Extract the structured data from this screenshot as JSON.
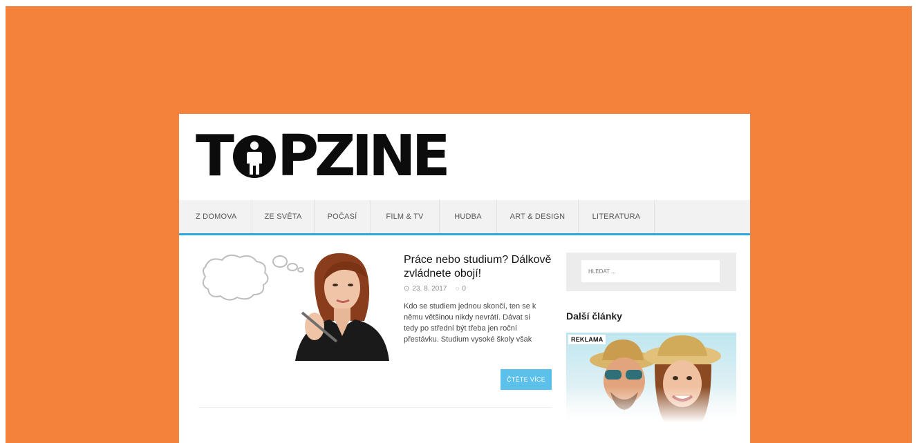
{
  "site": {
    "logo_text_start": "T",
    "logo_text_end": "PZINE",
    "logo_full": "TOPZINE"
  },
  "nav": {
    "items": [
      {
        "label": "Z DOMOVA"
      },
      {
        "label": "ZE SVĚTA"
      },
      {
        "label": "POČASÍ"
      },
      {
        "label": "FILM & TV"
      },
      {
        "label": "HUDBA"
      },
      {
        "label": "ART & DESIGN"
      },
      {
        "label": "LITERATURA"
      }
    ]
  },
  "article": {
    "title": "Práce nebo studium? Dálkově zvládnete obojí!",
    "date": "23. 8. 2017",
    "comments": "0",
    "excerpt": "Kdo se studiem jednou skončí, ten se k němu většinou nikdy nevrátí. Dávat si tedy po střední být třeba jen roční přestávku. Studium vysoké školy však",
    "read_more": "ČTĚTE VÍCE"
  },
  "sidebar": {
    "search_placeholder": "HLEDAT ...",
    "heading": "Další články",
    "ad_label": "REKLAMA"
  },
  "colors": {
    "background": "#f4823a",
    "accent": "#2ea7df",
    "button": "#5bc0ea"
  },
  "icons": {
    "date": "clock-icon",
    "comments": "comment-bubble-icon"
  }
}
